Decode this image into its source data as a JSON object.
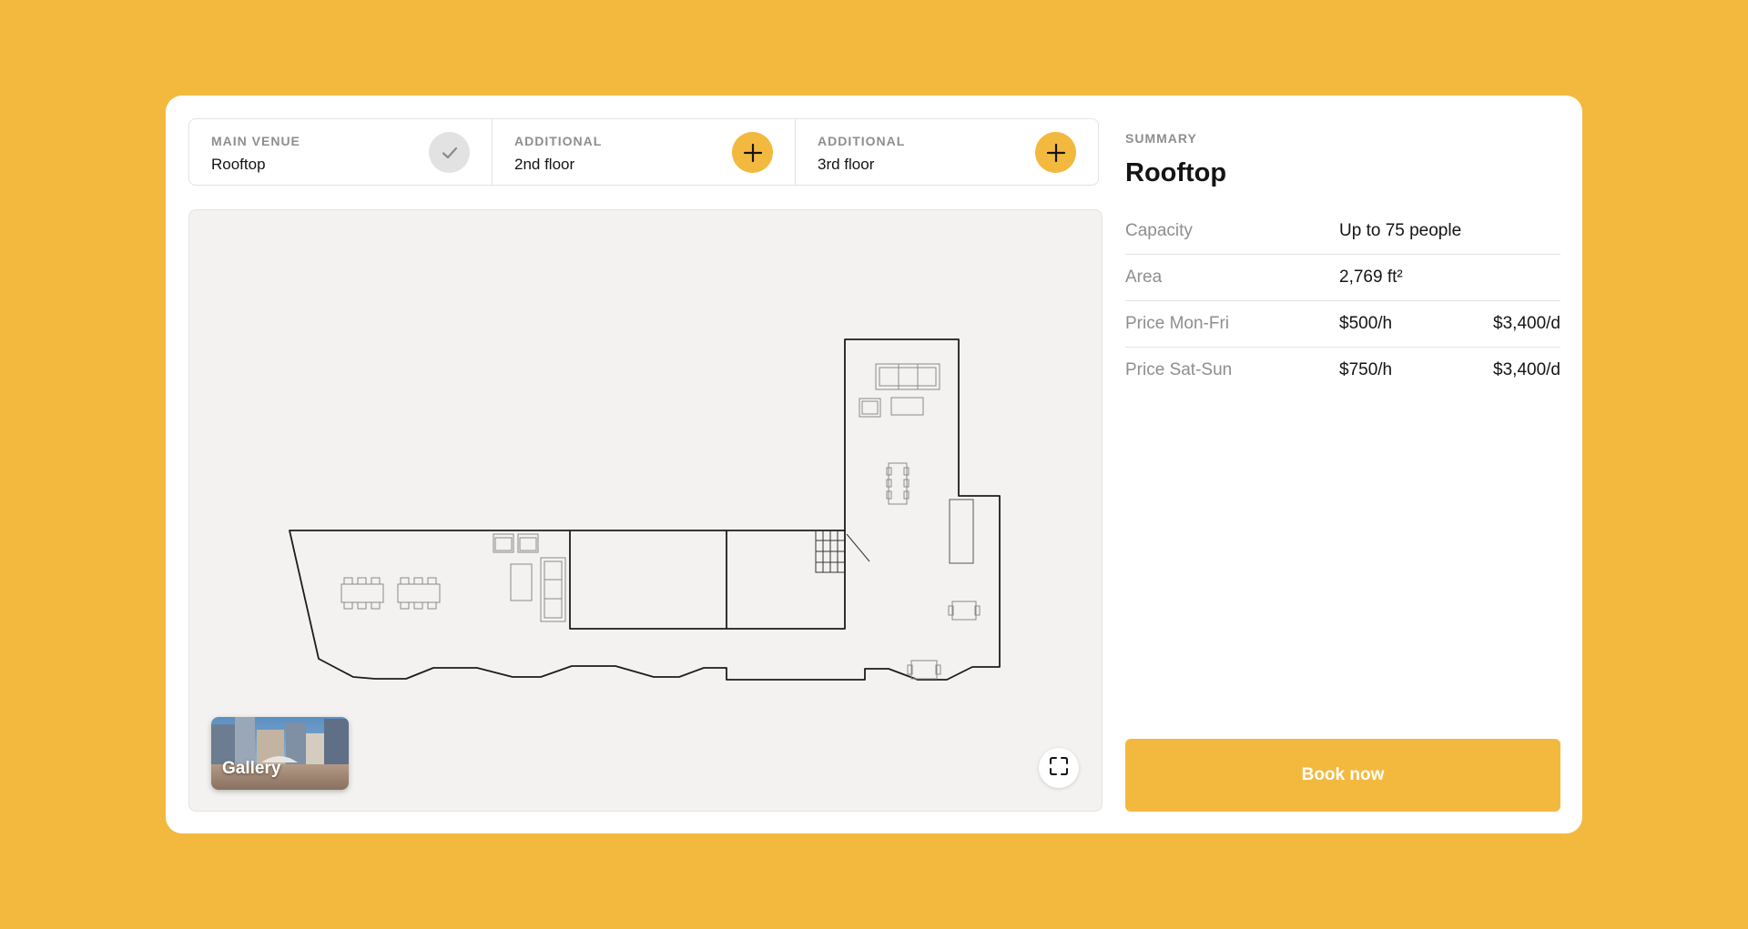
{
  "venues": [
    {
      "kicker": "MAIN VENUE",
      "name": "Rooftop",
      "state": "selected",
      "icon": "check-icon"
    },
    {
      "kicker": "ADDITIONAL",
      "name": "2nd floor",
      "state": "add",
      "icon": "plus-icon"
    },
    {
      "kicker": "ADDITIONAL",
      "name": "3rd floor",
      "state": "add",
      "icon": "plus-icon"
    }
  ],
  "plan": {
    "gallery_label": "Gallery",
    "expand_icon": "fullscreen-icon"
  },
  "summary": {
    "kicker": "SUMMARY",
    "title": "Rooftop",
    "rows": [
      {
        "label": "Capacity",
        "value": "Up to 75 people",
        "value2": ""
      },
      {
        "label": "Area",
        "value": "2,769 ft²",
        "value2": ""
      },
      {
        "label": "Price Mon-Fri",
        "value": "$500/h",
        "value2": "$3,400/d"
      },
      {
        "label": "Price Sat-Sun",
        "value": "$750/h",
        "value2": "$3,400/d"
      }
    ],
    "cta": "Book now"
  },
  "colors": {
    "accent": "#F3B93F",
    "background": "#F3B93F",
    "plan_bg": "#F3F2F0",
    "muted_text": "#8e8e8e"
  }
}
